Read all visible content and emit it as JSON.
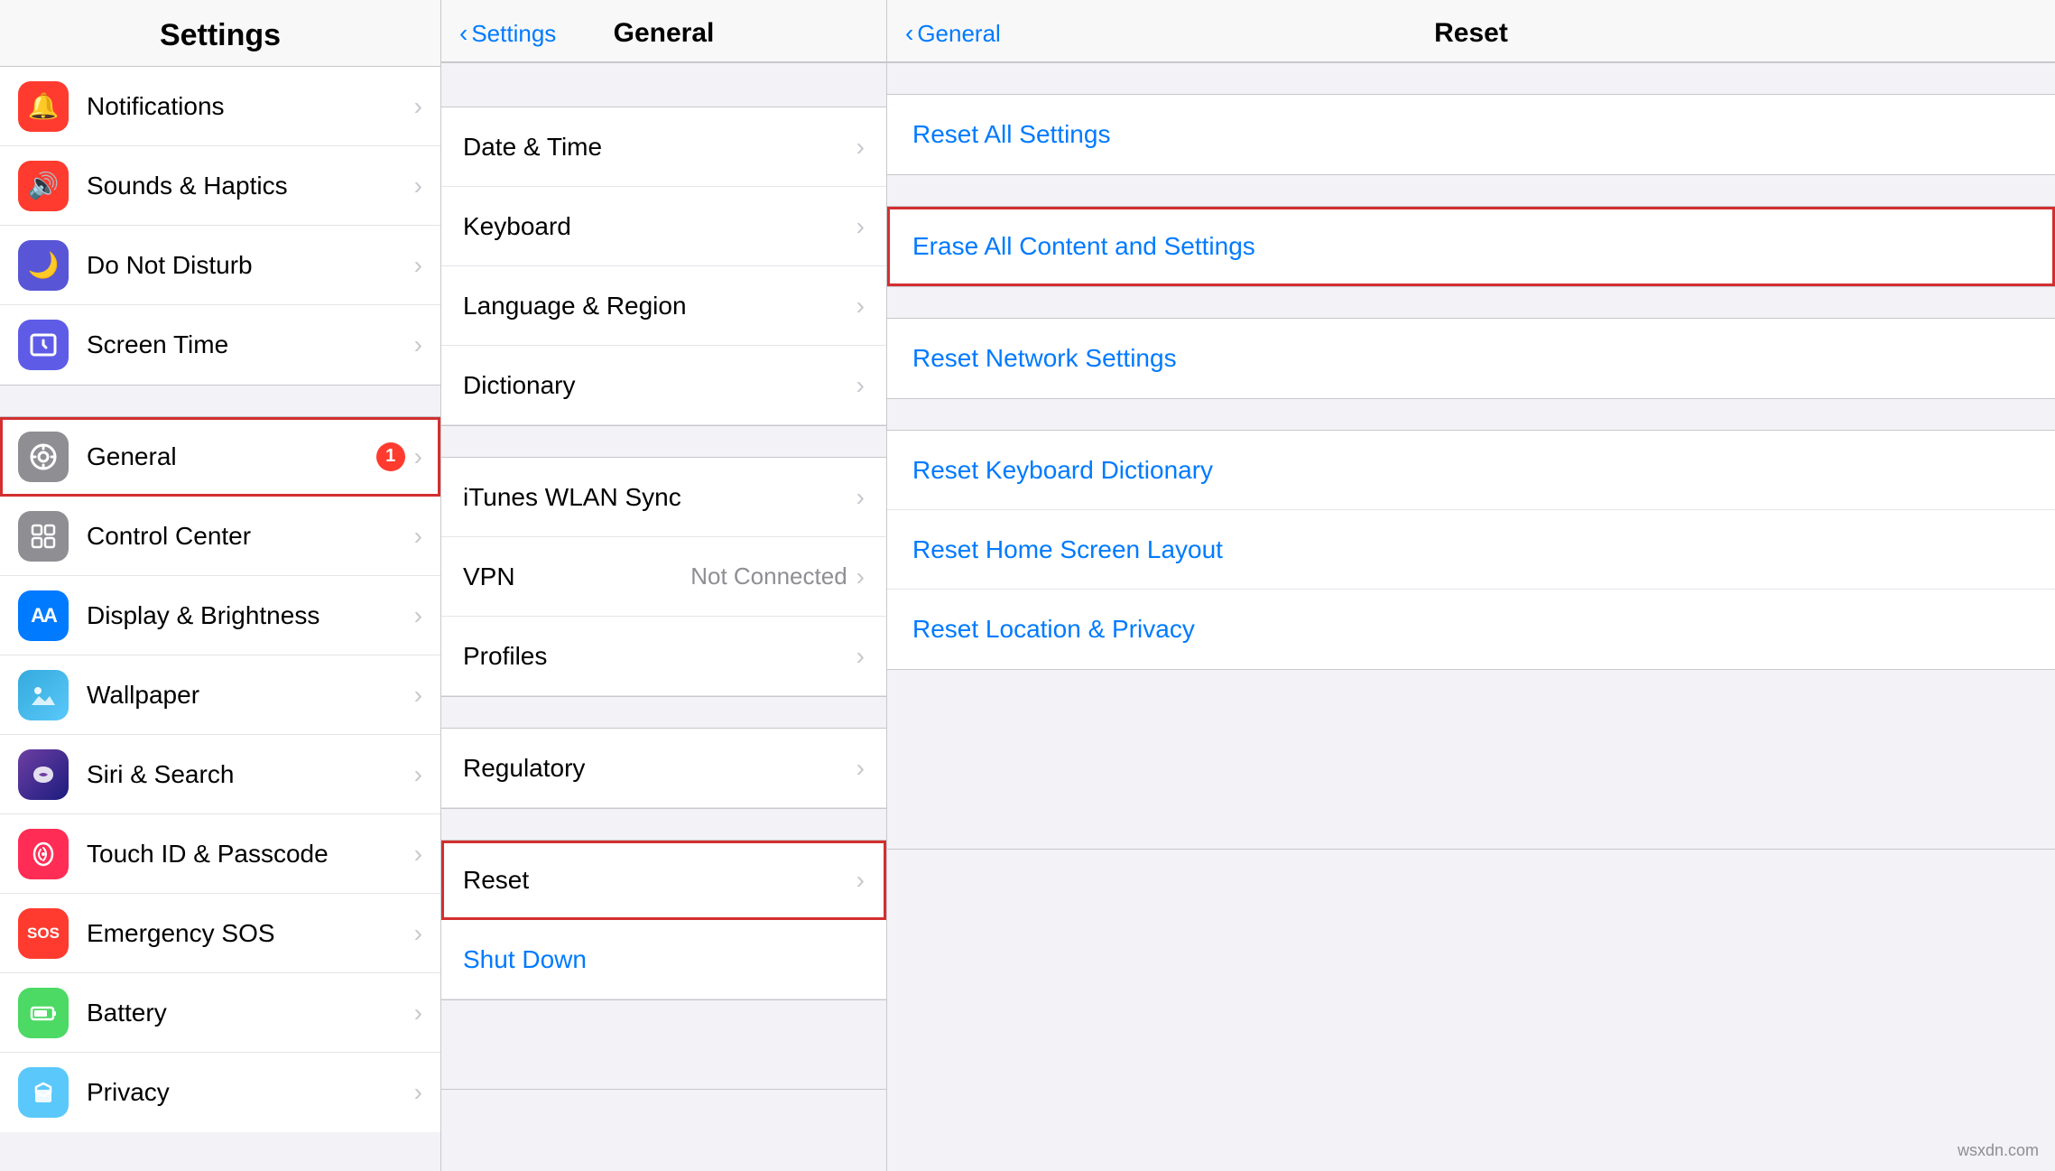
{
  "left_pane": {
    "title": "Settings",
    "items_section1": [
      {
        "id": "notifications",
        "label": "Notifications",
        "icon_bg": "#ff3b30",
        "icon": "🔔"
      },
      {
        "id": "sounds",
        "label": "Sounds & Haptics",
        "icon_bg": "#ff3b30",
        "icon": "🔊"
      },
      {
        "id": "donotdisturb",
        "label": "Do Not Disturb",
        "icon_bg": "#5856d6",
        "icon": "🌙"
      },
      {
        "id": "screentime",
        "label": "Screen Time",
        "icon_bg": "#6e6eb5",
        "icon": "⏳"
      }
    ],
    "items_section2": [
      {
        "id": "general",
        "label": "General",
        "icon_bg": "#8e8e93",
        "icon": "⚙️",
        "badge": "1",
        "highlighted": true
      },
      {
        "id": "controlcenter",
        "label": "Control Center",
        "icon_bg": "#8e8e93",
        "icon": "🎛"
      },
      {
        "id": "displaybrightness",
        "label": "Display & Brightness",
        "icon_bg": "#007aff",
        "icon": "AA"
      },
      {
        "id": "wallpaper",
        "label": "Wallpaper",
        "icon_bg": "#34aadc",
        "icon": "🌸"
      },
      {
        "id": "sirisearch",
        "label": "Siri & Search",
        "icon_bg": "#000",
        "icon": "✦"
      },
      {
        "id": "touchid",
        "label": "Touch ID & Passcode",
        "icon_bg": "#ff2d55",
        "icon": "👆"
      },
      {
        "id": "emergencysos",
        "label": "Emergency SOS",
        "icon_bg": "#ff3b30",
        "icon": "SOS"
      },
      {
        "id": "battery",
        "label": "Battery",
        "icon_bg": "#4cd964",
        "icon": "🔋"
      },
      {
        "id": "privacy",
        "label": "Privacy",
        "icon_bg": "#5ac8fa",
        "icon": "✋"
      }
    ]
  },
  "middle_pane": {
    "back_label": "Settings",
    "title": "General",
    "items_section1": [
      {
        "id": "datetime",
        "label": "Date & Time"
      },
      {
        "id": "keyboard",
        "label": "Keyboard"
      },
      {
        "id": "language",
        "label": "Language & Region"
      },
      {
        "id": "dictionary",
        "label": "Dictionary"
      }
    ],
    "items_section2": [
      {
        "id": "itunes",
        "label": "iTunes WLAN Sync"
      },
      {
        "id": "vpn",
        "label": "VPN",
        "value": "Not Connected"
      },
      {
        "id": "profiles",
        "label": "Profiles"
      }
    ],
    "items_section3": [
      {
        "id": "regulatory",
        "label": "Regulatory"
      }
    ],
    "items_section4": [
      {
        "id": "reset",
        "label": "Reset",
        "highlighted": true
      },
      {
        "id": "shutdown",
        "label": "Shut Down",
        "link": true
      }
    ]
  },
  "right_pane": {
    "back_label": "General",
    "title": "Reset",
    "section1": [
      {
        "id": "reset-all-settings",
        "label": "Reset All Settings"
      }
    ],
    "section2": [
      {
        "id": "erase-all",
        "label": "Erase All Content and Settings",
        "highlighted": true
      }
    ],
    "section3": [
      {
        "id": "reset-network",
        "label": "Reset Network Settings"
      }
    ],
    "section4": [
      {
        "id": "reset-keyboard",
        "label": "Reset Keyboard Dictionary"
      },
      {
        "id": "reset-homescreen",
        "label": "Reset Home Screen Layout"
      },
      {
        "id": "reset-location",
        "label": "Reset Location & Privacy"
      }
    ]
  },
  "watermark": "wsxdn.com"
}
